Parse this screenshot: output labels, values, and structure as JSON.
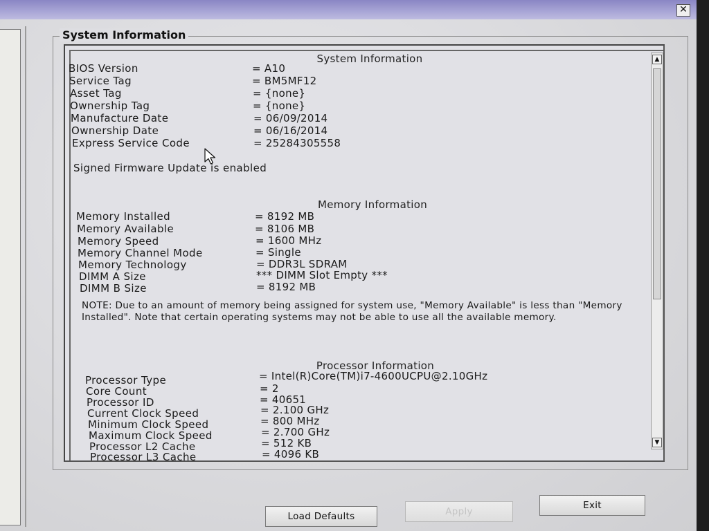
{
  "group_title": "System Information",
  "sections": {
    "system": {
      "title": "System Information",
      "rows": [
        {
          "label": "BIOS Version",
          "value": "= A10"
        },
        {
          "label": "Service Tag",
          "value": "= BM5MF12"
        },
        {
          "label": "Asset Tag",
          "value": "= {none}"
        },
        {
          "label": "Ownership Tag",
          "value": "= {none}"
        },
        {
          "label": "Manufacture Date",
          "value": "= 06/09/2014"
        },
        {
          "label": "Ownership Date",
          "value": "= 06/16/2014"
        },
        {
          "label": "Express Service Code",
          "value": "= 25284305558"
        }
      ],
      "status": "Signed Firmware Update is enabled"
    },
    "memory": {
      "title": "Memory Information",
      "rows": [
        {
          "label": "Memory Installed",
          "value": "= 8192 MB"
        },
        {
          "label": "Memory Available",
          "value": "= 8106 MB"
        },
        {
          "label": "Memory Speed",
          "value": "= 1600 MHz"
        },
        {
          "label": "Memory Channel Mode",
          "value": "= Single"
        },
        {
          "label": "Memory Technology",
          "value": "= DDR3L SDRAM"
        },
        {
          "label": "DIMM A Size",
          "value": "*** DIMM Slot Empty ***"
        },
        {
          "label": "DIMM B Size",
          "value": "= 8192 MB"
        }
      ],
      "note": "NOTE: Due to an amount of memory being assigned for system use, \"Memory Available\" is less than \"Memory Installed\". Note that certain operating systems may not be able to use all the available memory."
    },
    "processor": {
      "title": "Processor Information",
      "rows": [
        {
          "label": "Processor Type",
          "value": "= Intel(R)Core(TM)i7-4600UCPU@2.10GHz"
        },
        {
          "label": "Core Count",
          "value": "= 2"
        },
        {
          "label": "Processor ID",
          "value": "= 40651"
        },
        {
          "label": "Current Clock Speed",
          "value": "= 2.100 GHz"
        },
        {
          "label": "Minimum Clock Speed",
          "value": "= 800 MHz"
        },
        {
          "label": "Maximum Clock Speed",
          "value": "= 2.700 GHz"
        },
        {
          "label": "Processor L2 Cache",
          "value": "= 512 KB"
        },
        {
          "label": "Processor L3 Cache",
          "value": "= 4096 KB"
        }
      ]
    }
  },
  "buttons": {
    "load_defaults": "Load Defaults",
    "apply": "Apply",
    "exit": "Exit"
  },
  "icons": {
    "close": "close-icon",
    "scroll_up": "scroll-up-icon",
    "scroll_down": "scroll-down-icon",
    "cursor": "mouse-pointer-icon"
  },
  "colors": {
    "titlebar": "#a9a6d6",
    "panel_bg": "#e1e1e6",
    "window_bg": "#dcdcdc"
  }
}
